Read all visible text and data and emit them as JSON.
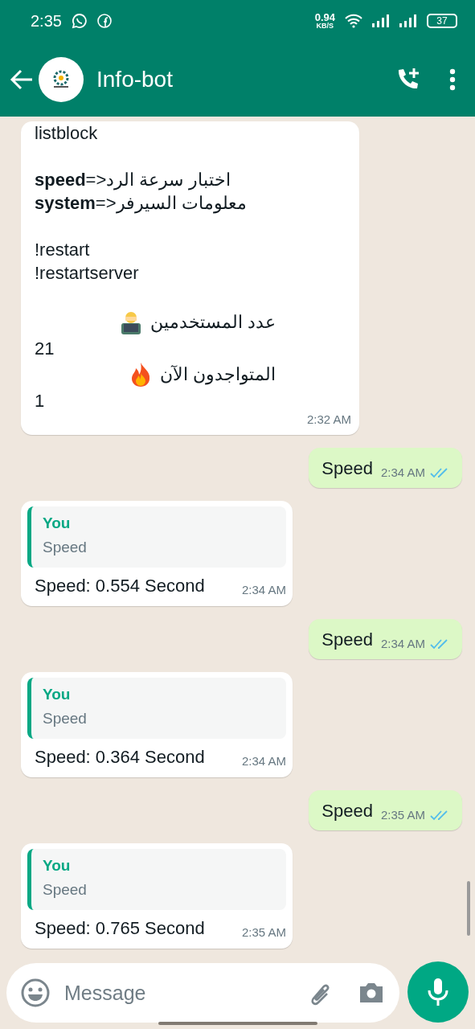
{
  "status_bar": {
    "time": "2:35",
    "net_speed": "0.94",
    "net_unit": "KB/S",
    "battery": "37"
  },
  "header": {
    "title": "Info-bot"
  },
  "messages": [
    {
      "kind": "bot_text",
      "time": "2:32 AM",
      "lines": [
        {
          "kind": "text",
          "text": "listblock"
        },
        {
          "kind": "blank"
        },
        {
          "kind": "text",
          "text": "**speed**=>اختبار سرعة الرد"
        },
        {
          "kind": "text",
          "text": "**system**=>معلومات السيرفر"
        },
        {
          "kind": "blank"
        },
        {
          "kind": "text",
          "text": "!restart"
        },
        {
          "kind": "text",
          "text": "!restartserver"
        },
        {
          "kind": "blank"
        },
        {
          "kind": "users",
          "text": "عدد المستخدمين"
        },
        {
          "kind": "text",
          "text": "21"
        },
        {
          "kind": "online",
          "text": "المتواجدون الآن"
        },
        {
          "kind": "text",
          "text": "1"
        }
      ]
    },
    {
      "kind": "outgoing",
      "text": "Speed",
      "time": "2:34 AM",
      "read": true
    },
    {
      "kind": "reply",
      "quote_author": "You",
      "quote_text": "Speed",
      "text": "Speed: 0.554 Second",
      "time": "2:34 AM"
    },
    {
      "kind": "outgoing",
      "text": "Speed",
      "time": "2:34 AM",
      "read": true
    },
    {
      "kind": "reply",
      "quote_author": "You",
      "quote_text": "Speed",
      "text": "Speed: 0.364 Second",
      "time": "2:34 AM"
    },
    {
      "kind": "outgoing",
      "text": "Speed",
      "time": "2:35 AM",
      "read": true
    },
    {
      "kind": "reply",
      "quote_author": "You",
      "quote_text": "Speed",
      "text": "Speed: 0.765 Second",
      "time": "2:35 AM"
    }
  ],
  "composer": {
    "placeholder": "Message"
  }
}
